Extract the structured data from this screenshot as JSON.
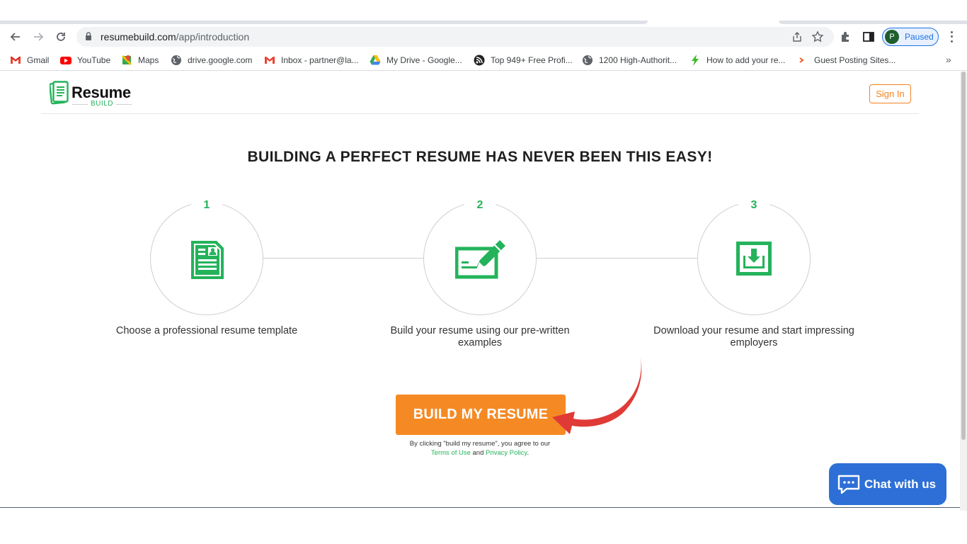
{
  "browser": {
    "url_host": "resumebuild.com",
    "url_path": "/app/introduction",
    "profile_initial": "P",
    "profile_status": "Paused"
  },
  "bookmarks": [
    {
      "label": "Gmail",
      "icon": "gmail-icon"
    },
    {
      "label": "YouTube",
      "icon": "youtube-icon"
    },
    {
      "label": "Maps",
      "icon": "maps-icon"
    },
    {
      "label": "drive.google.com",
      "icon": "globe-icon"
    },
    {
      "label": "Inbox - partner@la...",
      "icon": "gmail-icon"
    },
    {
      "label": "My Drive - Google...",
      "icon": "google-drive-icon"
    },
    {
      "label": "Top 949+ Free Profi...",
      "icon": "feed-icon"
    },
    {
      "label": "1200 High-Authorit...",
      "icon": "globe-icon"
    },
    {
      "label": "How to add your re...",
      "icon": "bolt-icon"
    },
    {
      "label": "Guest Posting Sites...",
      "icon": "arrow-icon"
    }
  ],
  "site": {
    "logo_word": "Resume",
    "logo_sub": "BUILD",
    "signin_label": "Sign In",
    "headline": "BUILDING A PERFECT RESUME HAS NEVER BEEN THIS EASY!",
    "steps": [
      {
        "number": "1",
        "text": "Choose a professional resume template",
        "icon": "resume-template-icon"
      },
      {
        "number": "2",
        "text": "Build your resume using our pre-written examples",
        "icon": "edit-form-icon"
      },
      {
        "number": "3",
        "text": "Download your resume and start impressing employers",
        "icon": "download-icon"
      }
    ],
    "cta_label": "BUILD MY RESUME",
    "legal_prefix": "By clicking \"build my resume\", you agree to our",
    "terms_label": "Terms of Use",
    "legal_and": "and",
    "privacy_label": "Privacy Policy",
    "legal_suffix": ".",
    "chat_label": "Chat with us"
  },
  "colors": {
    "brand_green": "#24b35b",
    "brand_orange": "#f58a24",
    "chat_blue": "#2d6fd6",
    "annotation_red": "#e03a36"
  }
}
